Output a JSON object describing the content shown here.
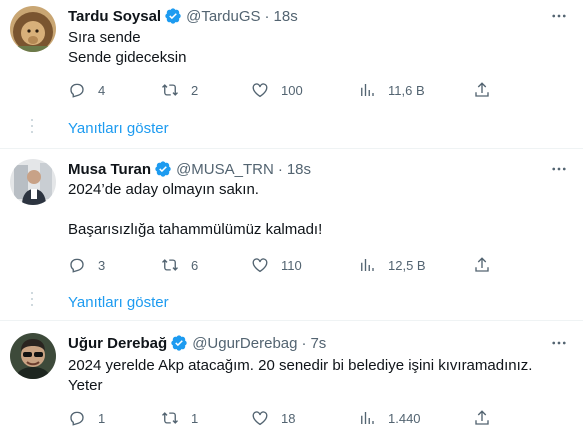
{
  "tweets": [
    {
      "name": "Tardu Soysal",
      "handle": "@TarduGS",
      "separator": "·",
      "time": "18s",
      "text": "Sıra sende\nSende gideceksin",
      "replies": "4",
      "retweets": "2",
      "likes": "100",
      "views": "11,6 B",
      "show_replies": "Yanıtları göster"
    },
    {
      "name": "Musa Turan",
      "handle": "@MUSA_TRN",
      "separator": "·",
      "time": "18s",
      "text": "2024’de aday olmayın sakın.\n\nBaşarısızlığa tahammülümüz kalmadı!",
      "replies": "3",
      "retweets": "6",
      "likes": "110",
      "views": "12,5 B",
      "show_replies": "Yanıtları göster"
    },
    {
      "name": "Uğur Derebağ",
      "handle": "@UgurDerebag",
      "separator": "·",
      "time": "7s",
      "text": "2024 yerelde Akp atacağım. 20 senedir bi belediye işini kıvıramadınız.\nYeter",
      "replies": "1",
      "retweets": "1",
      "likes": "18",
      "views": "1.440"
    }
  ],
  "icons": {
    "verified": "verified-badge-icon",
    "more": "more-options-icon",
    "reply": "reply-icon",
    "retweet": "retweet-icon",
    "like": "like-icon",
    "views": "views-icon",
    "share": "share-icon"
  },
  "colors": {
    "accent": "#1d9bf0",
    "secondary_text": "#536471",
    "divider": "#eff3f4"
  }
}
